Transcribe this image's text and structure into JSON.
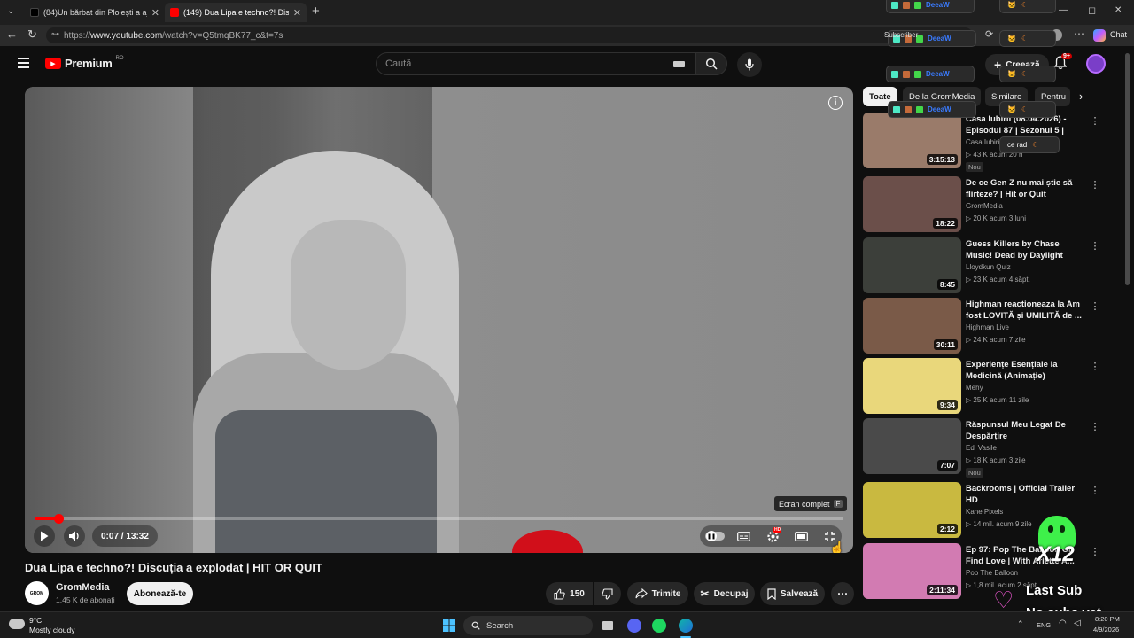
{
  "browser": {
    "tabs": [
      {
        "label": "(84)Un bărbat din Ploiești a ajuns",
        "active": false,
        "icon": "tiktok-icon"
      },
      {
        "label": "(149) Dua Lipa e techno?! Discuția",
        "active": true,
        "icon": "youtube-icon"
      }
    ],
    "url_prefix": "https://",
    "url_domain": "www.youtube.com",
    "url_path": "/watch?v=Q5tmqBK77_c&t=7s",
    "chat_label": "Chat",
    "window_controls": {
      "minimize": "—",
      "maximize": "◻",
      "close": "✕"
    }
  },
  "youtube": {
    "logo_text": "Premium",
    "logo_region": "RO",
    "search_placeholder": "Caută",
    "create_label": "Creează",
    "notif_badge": "9+"
  },
  "player": {
    "time_display": "0:07 / 13:32",
    "progress_fraction": 0.009,
    "tooltip_label": "Ecran complet",
    "tooltip_key": "F",
    "settings_badge": "HD"
  },
  "video": {
    "title": "Dua Lipa e techno?! Discuția a explodat | HIT OR QUIT",
    "channel_name": "GromMedia",
    "channel_avatar_text": "GROM",
    "subscribers": "1,45 K de abonați",
    "subscribe_label": "Abonează-te",
    "likes": "150",
    "share_label": "Trimite",
    "clip_label": "Decupaj",
    "save_label": "Salvează"
  },
  "chips": [
    "Toate",
    "De la GromMedia",
    "Similare",
    "Pentru"
  ],
  "recommendations": [
    {
      "title": "Casa Iubirii (08.04.2026) - Episodul 87 | Sezonul 5 | Editie...",
      "channel": "Casa Iubirii",
      "meta": "▷ 43 K  acum 20 h",
      "duration": "3:15:13",
      "badge": "Nou",
      "thumb": "#9a7b6a"
    },
    {
      "title": "De ce Gen Z nu mai știe să flirteze? | Hit or Quit",
      "channel": "GromMedia",
      "meta": "▷ 20 K  acum 3 luni",
      "duration": "18:22",
      "badge": "",
      "thumb": "#6b4f4a"
    },
    {
      "title": "Guess Killers by Chase Music! Dead by Daylight Music Quiz!",
      "channel": "Lloydkun Quiz",
      "meta": "▷ 23 K  acum 4 săpt.",
      "duration": "8:45",
      "badge": "",
      "thumb": "#3c3f3a"
    },
    {
      "title": "Highman reactioneaza la Am fost LOVITĂ și UMILITĂ de ...",
      "channel": "Highman Live",
      "meta": "▷ 24 K  acum 7 zile",
      "duration": "30:11",
      "badge": "",
      "thumb": "#7a5a48"
    },
    {
      "title": "Experiențe Esențiale la Medicină (Animație)",
      "channel": "Mehy",
      "meta": "▷ 25 K  acum 11 zile",
      "duration": "9:34",
      "badge": "",
      "thumb": "#e9d77b"
    },
    {
      "title": "Răspunsul Meu Legat De Despărțire",
      "channel": "Edi Vasile",
      "meta": "▷ 18 K  acum 3 zile",
      "duration": "7:07",
      "badge": "Nou",
      "thumb": "#4a4a4a"
    },
    {
      "title": "Backrooms | Official Trailer HD",
      "channel": "Kane Pixels",
      "meta": "▷ 14 mil.  acum 9 zile",
      "duration": "2:12",
      "badge": "",
      "thumb": "#c9b940"
    },
    {
      "title": "Ep 97: Pop The Balloon Or Find Love | With Arlette A...",
      "channel": "Pop The Balloon",
      "meta": "▷ 1,8 mil.  acum 2 săpt.",
      "duration": "2:11:34",
      "badge": "",
      "thumb": "#d27bb2"
    }
  ],
  "overlay": {
    "deeaw_label": "DeeaW",
    "cat_label": "ce rad",
    "last_sub": "Last Sub",
    "no_subs": "No subs yet",
    "x12": "X12",
    "sub_counter_label": "Subscriber"
  },
  "taskbar": {
    "weather_temp": "9°C",
    "weather_desc": "Mostly cloudy",
    "search_label": "Search",
    "lang": "ENG",
    "time": "8:20 PM",
    "date": "4/9/2026"
  },
  "colors": {
    "accent_red": "#ff0000",
    "bg": "#0f0f0f",
    "chip_active_bg": "#f1f1f1",
    "deeaw_blue": "#3a7bff",
    "ghost_green": "#3ef04a"
  }
}
